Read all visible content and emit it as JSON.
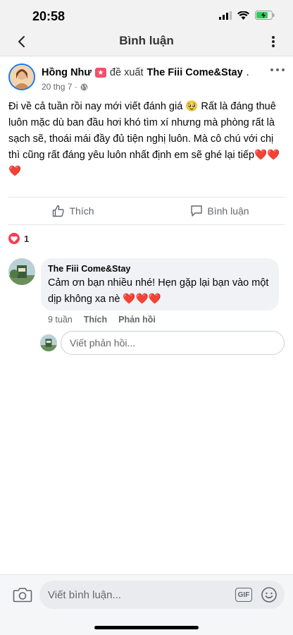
{
  "status_bar": {
    "time": "20:58"
  },
  "nav": {
    "title": "Bình luận"
  },
  "post": {
    "author": "Hồng Như",
    "recommend_text": "đề xuất",
    "page_name": "The Fiii Come&Stay",
    "page_suffix": ".",
    "date": "20 thg 7 ·",
    "body": "Đi về cả tuần rồi nay mới viết đánh giá 🥹 Rất là đáng thuê luôn mặc dù ban đầu hơi khó tìm xí nhưng mà phòng rất là sạch sẽ, thoái mái đầy đủ tiện nghị luôn. Mà cô chú với chị thì cũng rất đáng yêu luôn nhất định em sẽ ghé lại tiếp",
    "body_hearts": "❤️❤️❤️"
  },
  "actions": {
    "like_label": "Thích",
    "comment_label": "Bình luận"
  },
  "reactions": {
    "count": "1"
  },
  "reply": {
    "author": "The Fiii Come&Stay",
    "text": "Cảm ơn bạn nhiều nhé! Hẹn gặp lại bạn vào một dịp không xa nè",
    "hearts": "❤️❤️❤️",
    "time": "9 tuần",
    "like": "Thích",
    "respond": "Phản hồi"
  },
  "reply_input": {
    "placeholder": "Viết phản hồi..."
  },
  "bottom": {
    "placeholder": "Viết bình luận...",
    "gif_label": "GIF"
  },
  "colors": {
    "accent": "#1877f2",
    "heart": "#f33e58"
  }
}
